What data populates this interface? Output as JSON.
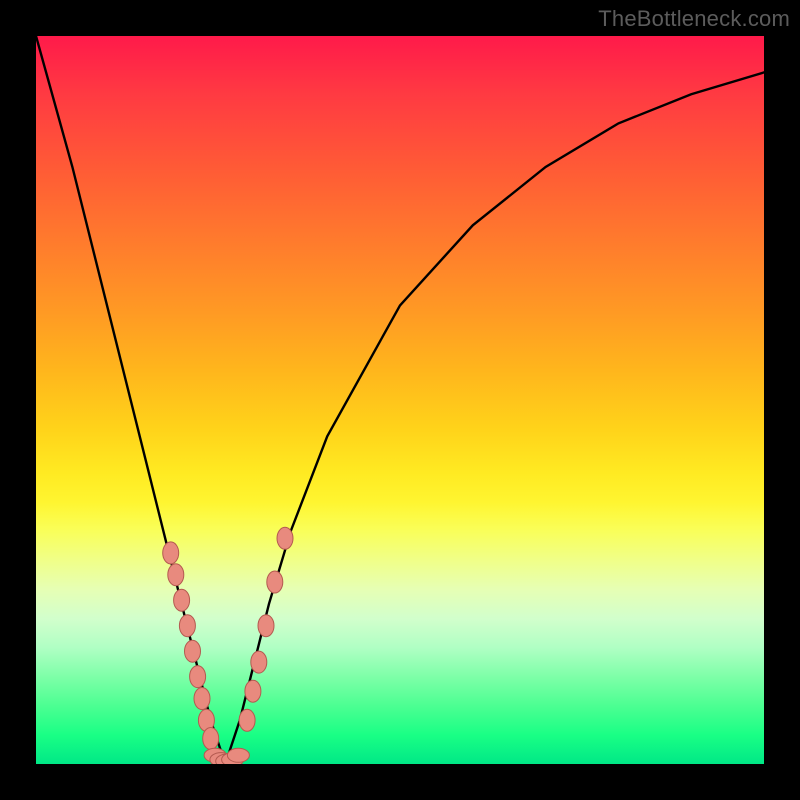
{
  "watermark": {
    "text": "TheBottleneck.com"
  },
  "colors": {
    "frame": "#000000",
    "curve": "#000000",
    "marker_fill": "#e88a7e",
    "marker_stroke": "#b45a50"
  },
  "chart_data": {
    "type": "line",
    "title": "",
    "xlabel": "",
    "ylabel": "",
    "xlim": [
      0,
      100
    ],
    "ylim": [
      0,
      100
    ],
    "grid": false,
    "legend": false,
    "note": "V-shaped bottleneck curve; y≈0 at x≈26; rises steeply toward both edges. Background gradient encodes y from ~100 (red) to ~0 (green).",
    "series": [
      {
        "name": "bottleneck-curve",
        "x": [
          0,
          5,
          10,
          15,
          18,
          20,
          22,
          24,
          26,
          28,
          30,
          32,
          35,
          40,
          50,
          60,
          70,
          80,
          90,
          100
        ],
        "y": [
          100,
          82,
          62,
          42,
          30,
          22,
          14,
          6,
          0,
          6,
          14,
          22,
          32,
          45,
          63,
          74,
          82,
          88,
          92,
          95
        ]
      },
      {
        "name": "markers-left-arm",
        "x": [
          18.5,
          19.2,
          20.0,
          20.8,
          21.5,
          22.2,
          22.8,
          23.4,
          24.0
        ],
        "y": [
          29,
          26,
          22.5,
          19,
          15.5,
          12,
          9,
          6,
          3.5
        ]
      },
      {
        "name": "markers-bottom",
        "x": [
          24.6,
          25.4,
          26.2,
          27.0,
          27.8
        ],
        "y": [
          1.2,
          0.6,
          0.4,
          0.6,
          1.2
        ]
      },
      {
        "name": "markers-right-arm",
        "x": [
          29.0,
          29.8,
          30.6,
          31.6,
          32.8,
          34.2
        ],
        "y": [
          6,
          10,
          14,
          19,
          25,
          31
        ]
      }
    ]
  }
}
